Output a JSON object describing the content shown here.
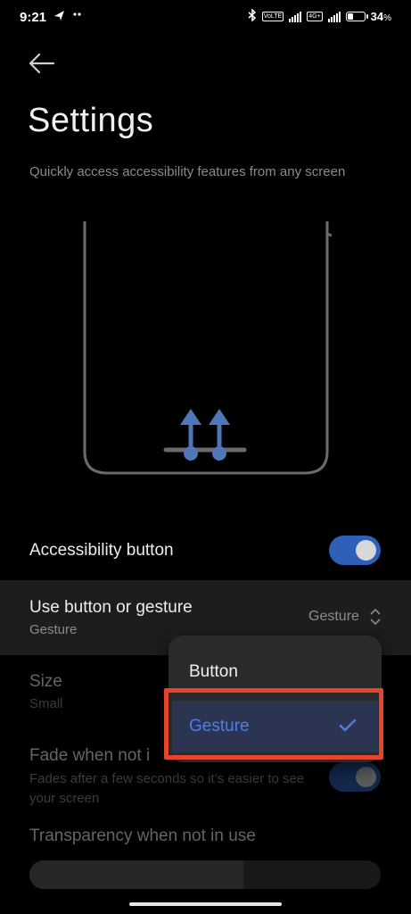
{
  "status_bar": {
    "time": "9:21",
    "battery_percent": "34",
    "battery_unit": "%",
    "battery_level": 0.34,
    "network_badge_1": "VoLTE",
    "network_badge_2": "4G+"
  },
  "header": {
    "title": "Settings",
    "subtitle": "Quickly access accessibility features from any screen"
  },
  "rows": {
    "accessibility_button": {
      "label": "Accessibility button",
      "enabled": true
    },
    "use_button_or_gesture": {
      "label": "Use button or gesture",
      "value": "Gesture",
      "selector_value": "Gesture"
    },
    "size": {
      "label": "Size",
      "value": "Small"
    },
    "fade": {
      "label": "Fade when not i",
      "description": "Fades after a few seconds so it’s easier to see your screen",
      "enabled": false
    },
    "transparency": {
      "label": "Transparency when not in use",
      "level": 0.61
    }
  },
  "dropdown": {
    "options": [
      {
        "label": "Button",
        "selected": false
      },
      {
        "label": "Gesture",
        "selected": true
      }
    ]
  },
  "colors": {
    "accent": "#2f5fb6",
    "selected_text": "#4f7de6",
    "highlight_frame": "#e5452a",
    "illustration_arrow": "#4f76b8"
  }
}
